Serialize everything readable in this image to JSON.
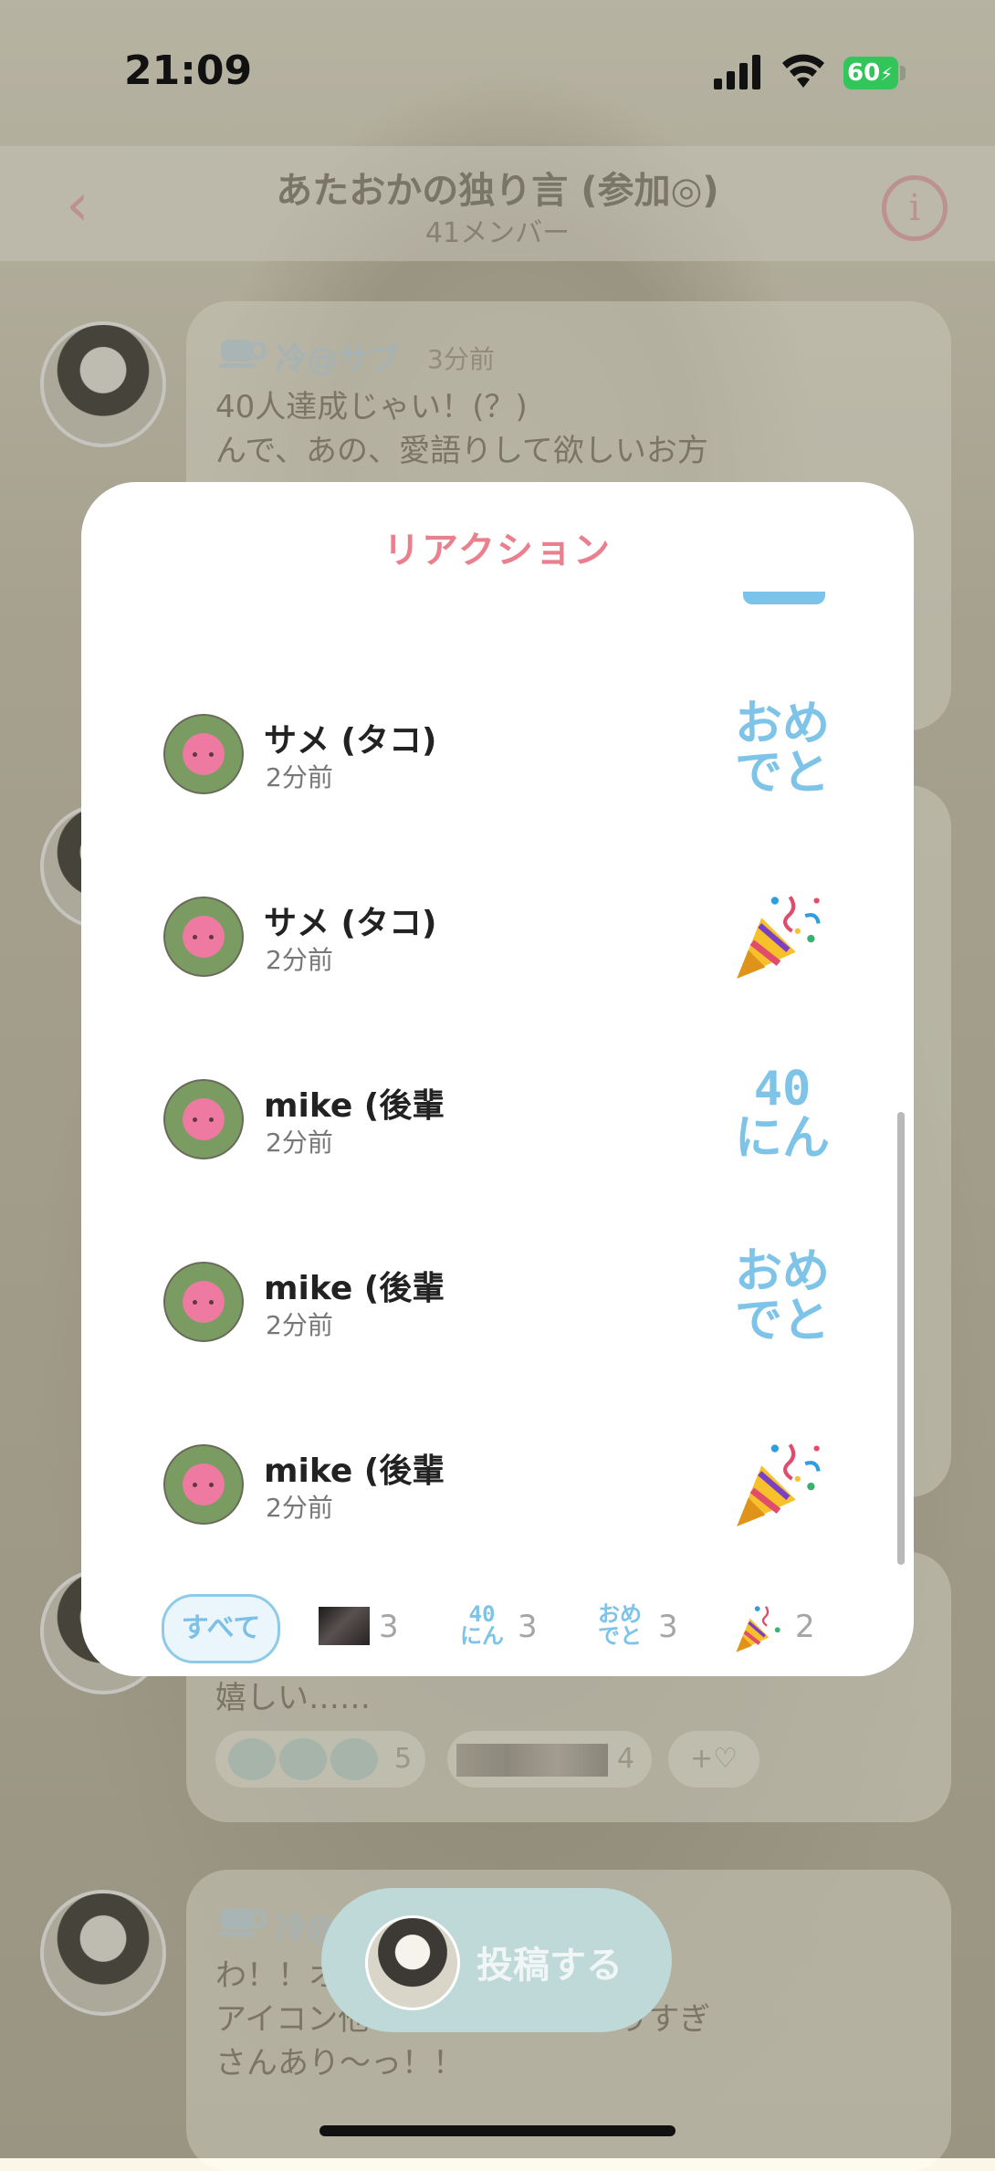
{
  "status": {
    "time": "21:09",
    "battery": "60"
  },
  "room": {
    "title": "あたおかの独り言 (参加◎)",
    "members": "41メンバー"
  },
  "background_posts": [
    {
      "name": "冷@サブ",
      "time": "3分前",
      "text": "40人達成じゃい！(？)\nんで、あの、愛語りして欲しいお方"
    },
    {
      "text": "嬉しい……",
      "reactions": [
        {
          "count": "5"
        },
        {
          "count": "4"
        }
      ],
      "add": "+♡"
    },
    {
      "name": "冷@サブ",
      "text": "わ！！オ\nアイコン他　　　　　　くありすぎ\nさんあり〜っ！！"
    }
  ],
  "fab": {
    "label": "投稿する"
  },
  "sheet": {
    "title": "リアクション",
    "rows": [
      {
        "name": "サメ (タコ)",
        "time": "2分前",
        "stamp": "おめ\nでと",
        "kind": "text"
      },
      {
        "name": "サメ (タコ)",
        "time": "2分前",
        "stamp": "party-popper",
        "kind": "icon"
      },
      {
        "name": "mike (後輩",
        "time": "2分前",
        "stamp": "40\nにん",
        "kind": "text"
      },
      {
        "name": "mike (後輩",
        "time": "2分前",
        "stamp": "おめ\nでと",
        "kind": "text"
      },
      {
        "name": "mike (後輩",
        "time": "2分前",
        "stamp": "party-popper",
        "kind": "icon"
      }
    ],
    "filters": {
      "all": "すべて",
      "photo_count": "3",
      "forty": {
        "stamp": "40\nにん",
        "count": "3"
      },
      "omedeto": {
        "stamp": "おめ\nでと",
        "count": "3"
      },
      "party_count": "2"
    }
  },
  "colors": {
    "accent_pink": "#ea7f8e",
    "stamp_blue": "#7ec3e8"
  }
}
